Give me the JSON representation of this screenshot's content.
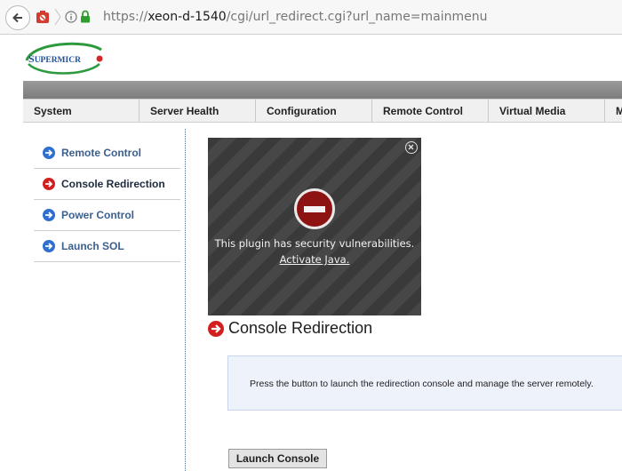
{
  "browser": {
    "url_prefix": "https://",
    "url_host": "xeon-d-1540",
    "url_path": "/cgi/url_redirect.cgi?url_name=mainmenu"
  },
  "logo": {
    "text": "SUPERMICRO"
  },
  "nav": {
    "items": [
      "System",
      "Server Health",
      "Configuration",
      "Remote Control",
      "Virtual Media",
      "M"
    ]
  },
  "sidebar": {
    "items": [
      {
        "label": "Remote Control",
        "icon": "arrow-right-icon",
        "color": "#2f6fd0"
      },
      {
        "label": "Console Redirection",
        "icon": "arrow-right-icon",
        "color": "#d21f1f",
        "active": true
      },
      {
        "label": "Power Control",
        "icon": "arrow-right-icon",
        "color": "#2f6fd0"
      },
      {
        "label": "Launch SOL",
        "icon": "arrow-right-icon",
        "color": "#2f6fd0"
      }
    ]
  },
  "plugin": {
    "message": "This plugin has security vulnerabilities.",
    "link": "Activate Java."
  },
  "main": {
    "heading": "Console Redirection",
    "info": "Press the button to launch the redirection console and manage the server remotely.",
    "launch_label": "Launch Console"
  }
}
